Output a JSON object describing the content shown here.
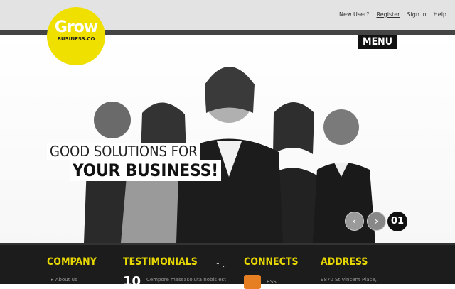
{
  "logo": {
    "title": "Grow",
    "subtitle": "BUSINESS.CO"
  },
  "nav": {
    "new_user": "New User?",
    "register": "Register",
    "signin": "Sign in",
    "help": "Help"
  },
  "menu": {
    "label": "MENU"
  },
  "hero": {
    "slogan_line1": "GOOD SOLUTIONS FOR",
    "slogan_line2": "YOUR BUSINESS!",
    "slide_number": "01",
    "prev_arrow": "‹",
    "next_arrow": "›"
  },
  "footer": {
    "company": {
      "heading": "COMPANY",
      "first_link": "About us"
    },
    "testimonials": {
      "heading": "TESTIMONIALS",
      "number": "10",
      "text": "Cempore massasoluta nobis est",
      "controls": "⌃⌄"
    },
    "connects": {
      "heading": "CONNECTS",
      "rss": "RSS"
    },
    "address": {
      "heading": "ADDRESS",
      "line1": "9870 St Vincent Place,"
    }
  },
  "colors": {
    "accent": "#f0e000",
    "footer_bg": "#1c1c1c",
    "dark": "#111111"
  }
}
